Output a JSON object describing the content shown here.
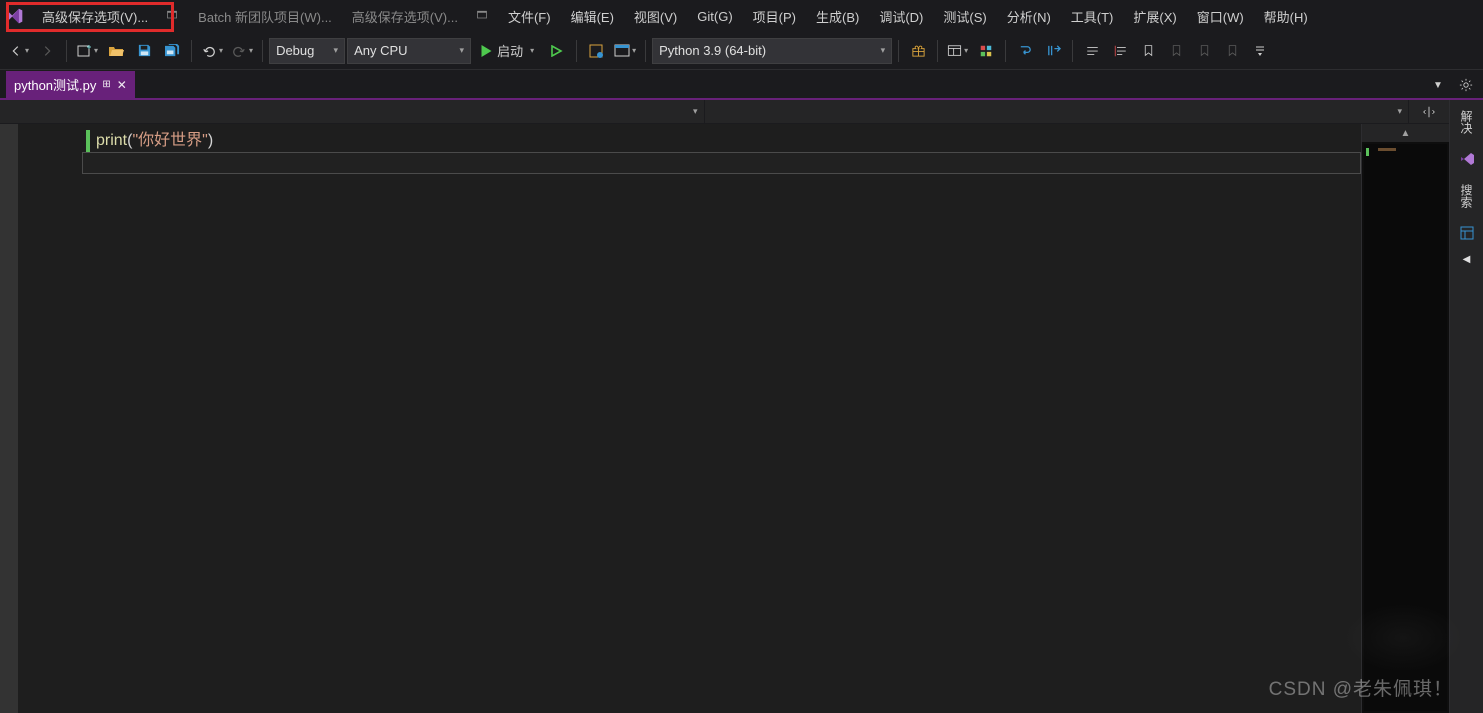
{
  "menubar": {
    "highlight_item": "高级保存选项(V)...",
    "dim_items": [
      "Batch 新团队项目(W)...",
      "高级保存选项(V)..."
    ],
    "items": [
      "文件(F)",
      "编辑(E)",
      "视图(V)",
      "Git(G)",
      "项目(P)",
      "生成(B)",
      "调试(D)",
      "测试(S)",
      "分析(N)",
      "工具(T)",
      "扩展(X)",
      "窗口(W)",
      "帮助(H)"
    ]
  },
  "toolbar": {
    "config": "Debug",
    "platform": "Any CPU",
    "run_label": "启动",
    "env": "Python 3.9 (64-bit)"
  },
  "tab": {
    "filename": "python测试.py"
  },
  "rightdock": {
    "label1": "解决",
    "label2": "搜索"
  },
  "code": {
    "tok_print": "print",
    "tok_open": "(",
    "tok_str": "\"你好世界\"",
    "tok_close": ")"
  },
  "watermark": "CSDN @老朱佩琪！"
}
